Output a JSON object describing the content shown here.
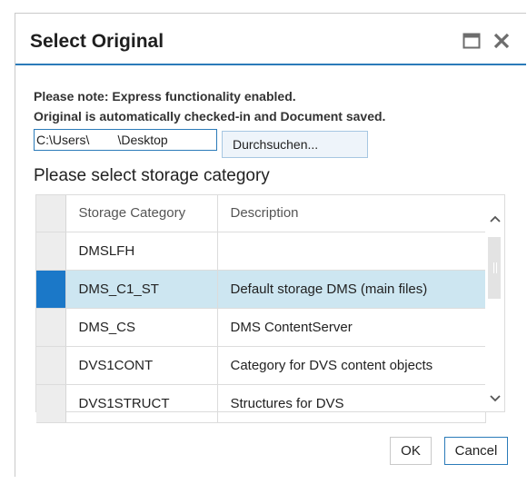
{
  "dialog": {
    "title": "Select Original",
    "maximize_icon": "maximize-icon",
    "close_icon": "close-icon"
  },
  "notes": {
    "line1": "Please note: Express functionality enabled.",
    "line2": "Original is automatically checked-in and Document saved."
  },
  "file": {
    "path_value": "C:\\Users\\        \\Desktop",
    "browse_label": "Durchsuchen..."
  },
  "storage": {
    "section_title": "Please select storage category",
    "columns": [
      "Storage Category",
      "Description"
    ],
    "rows": [
      {
        "category": "DMSLFH",
        "description": ""
      },
      {
        "category": "DMS_C1_ST",
        "description": "Default storage DMS (main files)"
      },
      {
        "category": "DMS_CS",
        "description": "DMS ContentServer"
      },
      {
        "category": "DVS1CONT",
        "description": "Category for DVS content objects"
      },
      {
        "category": "DVS1STRUCT",
        "description": "Structures for DVS"
      }
    ],
    "selected_row": 1
  },
  "buttons": {
    "ok": "OK",
    "cancel": "Cancel"
  },
  "colors": {
    "accent": "#2b7bb9",
    "selected_row": "#cde6f1",
    "selected_marker": "#1b78c8"
  }
}
